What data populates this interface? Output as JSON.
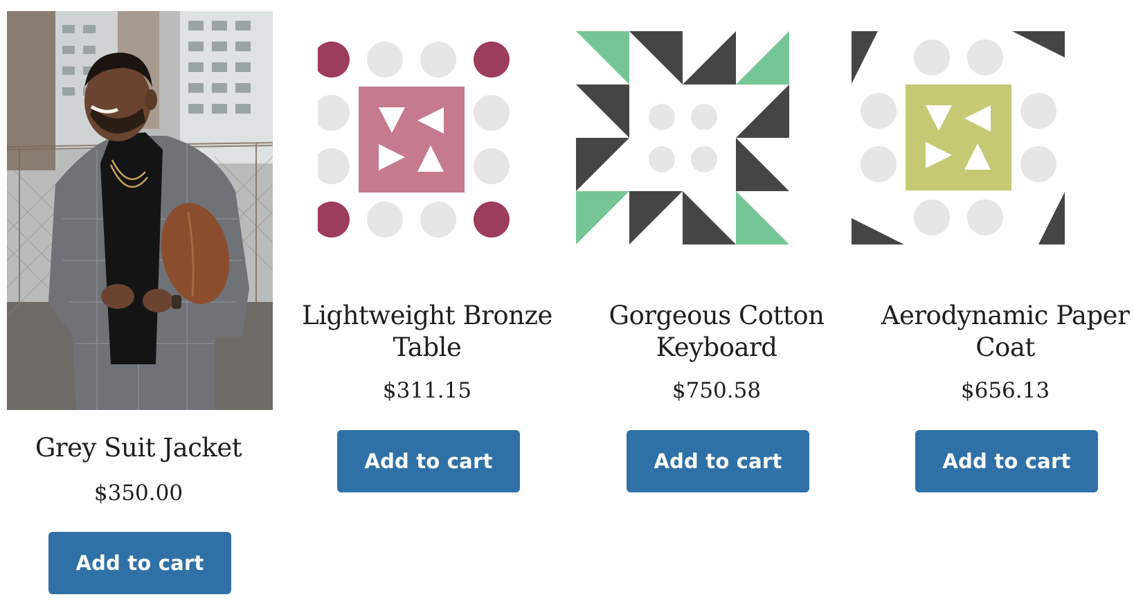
{
  "colors": {
    "button_bg": "#2f71a7",
    "button_text": "#ffffff",
    "text": "#1e1e1e",
    "dot_light": "#e6e6e6",
    "dot_wine": "#9c3d59",
    "square_pink": "#c57a8e",
    "square_olive": "#c5c974",
    "triangle_dark": "#454545",
    "triangle_green": "#76c596"
  },
  "products": [
    {
      "image": "grey-suit-jacket-photo",
      "title": "Grey Suit Jacket",
      "price": "$350.00",
      "button_label": "Add to cart"
    },
    {
      "image": "dots-and-pink-square-pattern",
      "title": "Lightweight Bronze Table",
      "price": "$311.15",
      "button_label": "Add to cart"
    },
    {
      "image": "green-and-dark-star-pattern",
      "title": "Gorgeous Cotton Keyboard",
      "price": "$750.58",
      "button_label": "Add to cart"
    },
    {
      "image": "dots-and-olive-square-pattern",
      "title": "Aerodynamic Paper Coat",
      "price": "$656.13",
      "button_label": "Add to cart"
    }
  ]
}
